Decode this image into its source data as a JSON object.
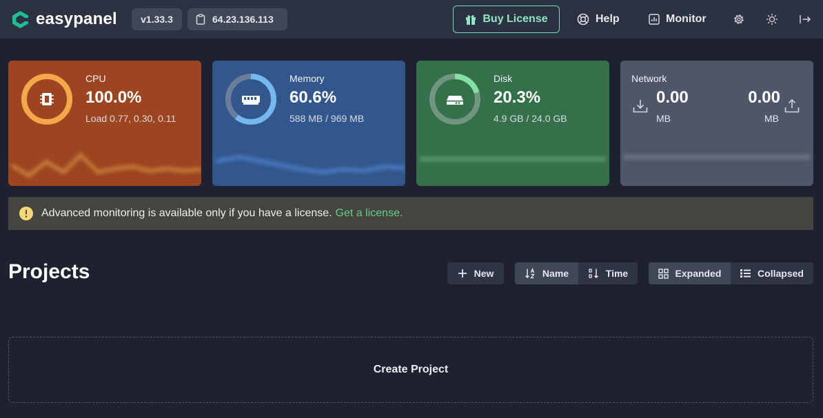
{
  "header": {
    "brand": "easypanel",
    "version": "v1.33.3",
    "ip": "64.23.136.113",
    "buy_license": "Buy License",
    "help": "Help",
    "monitor": "Monitor",
    "icons": [
      "gift-icon",
      "lifebuoy-icon",
      "chart-icon",
      "gear-icon",
      "sun-icon",
      "logout-icon"
    ]
  },
  "cards": {
    "cpu": {
      "label": "CPU",
      "value": "100.0%",
      "sub": "Load 0.77, 0.30, 0.11",
      "percent": 100
    },
    "memory": {
      "label": "Memory",
      "value": "60.6%",
      "sub": "588 MB / 969 MB",
      "percent": 60.6
    },
    "disk": {
      "label": "Disk",
      "value": "20.3%",
      "sub": "4.9 GB / 24.0 GB",
      "percent": 20.3
    },
    "network": {
      "label": "Network",
      "in_value": "0.00",
      "in_unit": "MB",
      "out_value": "0.00",
      "out_unit": "MB"
    }
  },
  "alert": {
    "text": "Advanced monitoring is available only if you have a license.",
    "link": "Get a license."
  },
  "projects": {
    "title": "Projects",
    "new": "New",
    "sort_name": "Name",
    "sort_time": "Time",
    "view_expanded": "Expanded",
    "view_collapsed": "Collapsed",
    "create": "Create Project"
  },
  "colors": {
    "cpu": "#9c4520",
    "memory": "#31578c",
    "disk": "#34704a",
    "network": "#4f5669",
    "accent": "#5fd08c"
  }
}
